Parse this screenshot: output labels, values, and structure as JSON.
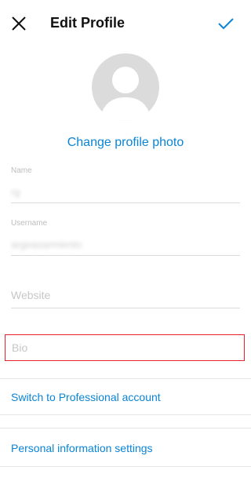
{
  "header": {
    "title": "Edit Profile"
  },
  "profile": {
    "change_photo_label": "Change profile photo"
  },
  "fields": {
    "name": {
      "label": "Name",
      "value": "rg"
    },
    "username": {
      "label": "Username",
      "value": "argeasarmiento"
    },
    "website": {
      "placeholder": "Website"
    },
    "bio": {
      "placeholder": "Bio"
    }
  },
  "links": {
    "professional": "Switch to Professional account",
    "personal_info": "Personal information settings"
  },
  "colors": {
    "accent": "#0a84d6",
    "highlight": "#e8202a"
  }
}
